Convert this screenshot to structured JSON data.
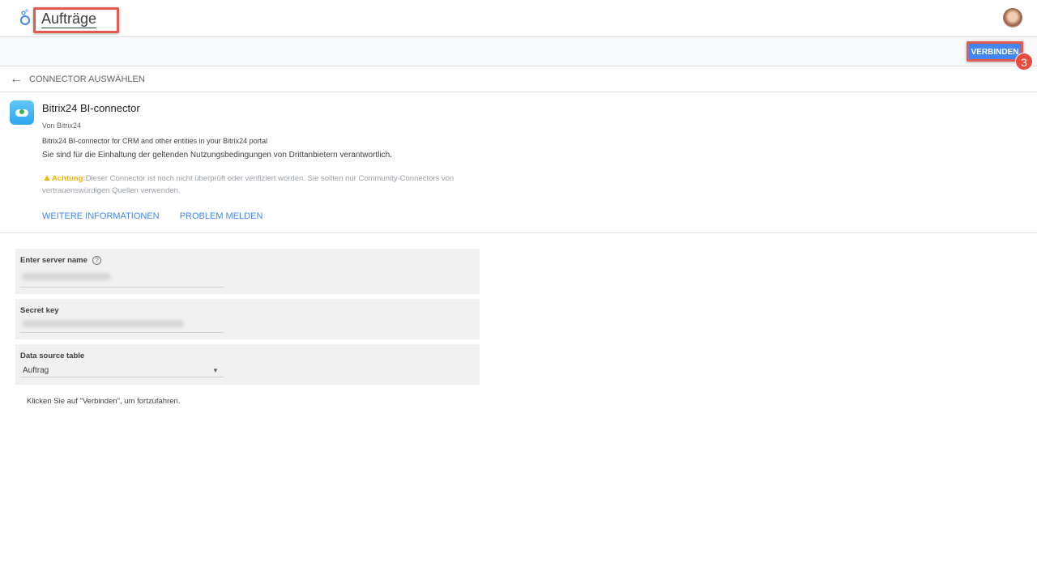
{
  "header": {
    "title": "Aufträge"
  },
  "toolbar": {
    "connect_label": "VERBINDEN",
    "step_badge": "3"
  },
  "nav": {
    "back_label": "CONNECTOR AUSWÄHLEN"
  },
  "connector": {
    "name": "Bitrix24 BI-connector",
    "by": "Von Bitrix24",
    "description": "Bitrix24 BI-connector for CRM and other entities in your Bitrix24 portal",
    "terms": "Sie sind für die Einhaltung der geltenden Nutzungsbedingungen von Drittanbietern verantwortlich.",
    "warning_label": "Achtung:",
    "warning_text": "Dieser Connector ist noch nicht überprüft oder verifiziert worden. Sie sollten nur Community-Connectors von vertrauenswürdigen Quellen verwenden.",
    "more_info": "WEITERE INFORMATIONEN",
    "report": "PROBLEM MELDEN"
  },
  "form": {
    "server_label": "Enter server name",
    "help_icon": "?",
    "secret_label": "Secret key",
    "table_label": "Data source table",
    "table_value": "Auftrag",
    "hint": "Klicken Sie auf \"Verbinden\", um fortzufahren."
  }
}
